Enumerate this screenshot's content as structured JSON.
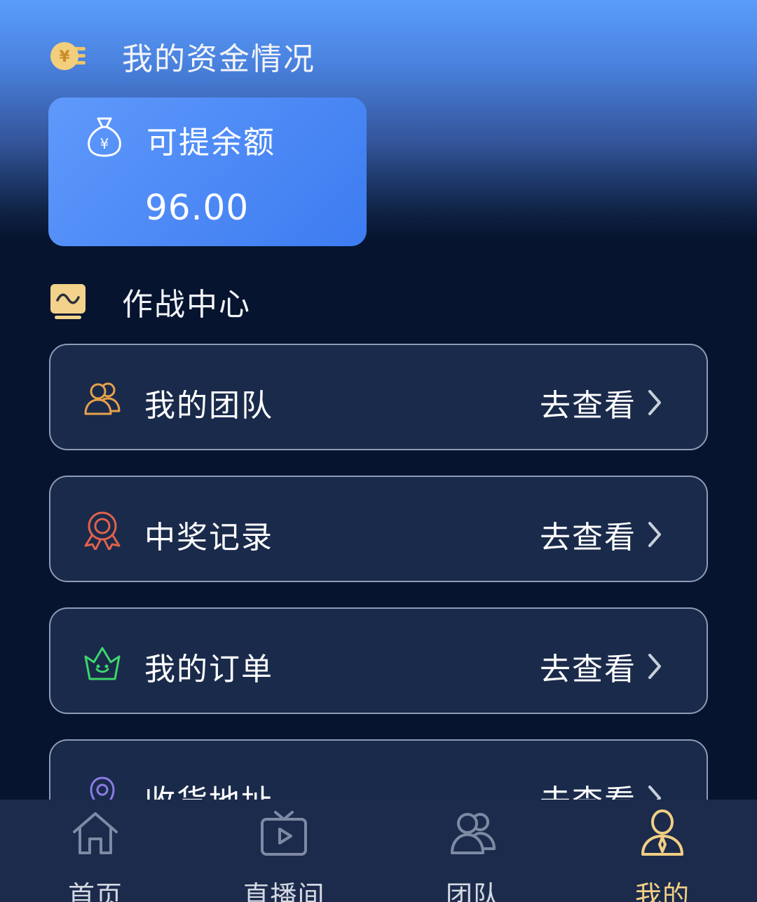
{
  "funds_section": {
    "title": "我的资金情况",
    "icon": "yen-coin-icon"
  },
  "balance_card": {
    "label": "可提余额",
    "value": "96.00",
    "icon": "money-bag-icon"
  },
  "combat_section": {
    "title": "作战中心",
    "icon": "trend-wave-icon"
  },
  "menu": [
    {
      "label": "我的团队",
      "action": "去查看",
      "icon": "team-icon",
      "icon_color": "#e7a24a"
    },
    {
      "label": "中奖记录",
      "action": "去查看",
      "icon": "award-ribbon-icon",
      "icon_color": "#e0624c"
    },
    {
      "label": "我的订单",
      "action": "去查看",
      "icon": "crown-basket-icon",
      "icon_color": "#3dd66b"
    },
    {
      "label": "收货地址",
      "action": "去查看",
      "icon": "location-pin-icon",
      "icon_color": "#8b7ce6"
    }
  ],
  "tabbar": {
    "items": [
      {
        "label": "首页",
        "icon": "home-icon",
        "active": false
      },
      {
        "label": "直播间",
        "icon": "live-tv-icon",
        "active": false
      },
      {
        "label": "团队",
        "icon": "team-icon",
        "active": false
      },
      {
        "label": "我的",
        "icon": "profile-icon",
        "active": true
      }
    ],
    "active_color": "#f1cf84",
    "inactive_color": "#7e8aa3"
  }
}
